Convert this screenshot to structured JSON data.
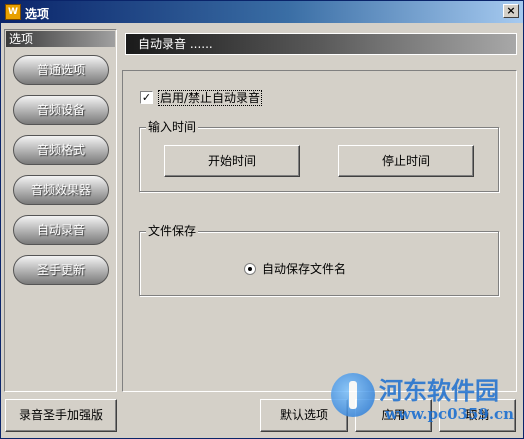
{
  "window": {
    "title": "选项",
    "icon": "app-logo-icon",
    "close_glyph": "×"
  },
  "sidebar": {
    "header": "选项",
    "items": [
      {
        "label": "普通选项"
      },
      {
        "label": "音频设备"
      },
      {
        "label": "音频格式"
      },
      {
        "label": "音频效果器"
      },
      {
        "label": "自动录音"
      },
      {
        "label": "圣手更新"
      }
    ]
  },
  "section": {
    "title": "自动录音 ......"
  },
  "auto_record": {
    "enable_label": "启用/禁止自动录音",
    "enable_checked": true,
    "input_time_group": "输入时间",
    "start_button": "开始时间",
    "stop_button": "停止时间",
    "file_save_group": "文件保存",
    "auto_save_label": "自动保存文件名",
    "auto_save_selected": true
  },
  "footer": {
    "brand_button": "录音圣手加强版",
    "default_button": "默认选项",
    "apply_button": "应用",
    "cancel_button": "取消"
  },
  "watermark": {
    "name": "河东软件园",
    "url": "www.pc0359.cn"
  }
}
